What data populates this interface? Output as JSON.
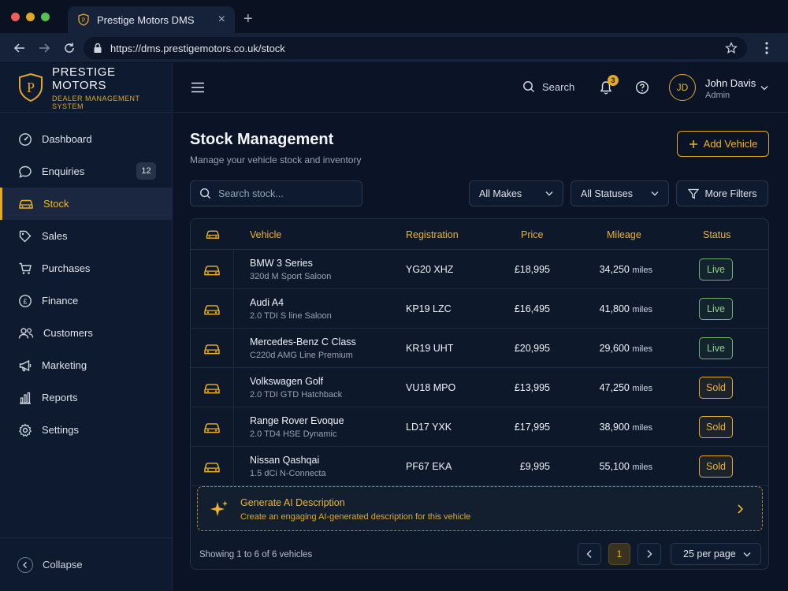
{
  "browser": {
    "tab_title": "Prestige Motors DMS",
    "url": "https://dms.prestigemotors.co.uk/stock"
  },
  "brand": {
    "name": "PRESTIGE MOTORS",
    "subtitle": "DEALER MANAGEMENT SYSTEM",
    "logo_letter": "P"
  },
  "sidebar": {
    "items": [
      {
        "label": "Dashboard",
        "icon": "gauge-icon"
      },
      {
        "label": "Enquiries",
        "icon": "chat-bubble-icon",
        "badge": "12"
      },
      {
        "label": "Stock",
        "icon": "car-icon",
        "active": true
      },
      {
        "label": "Sales",
        "icon": "tag-icon"
      },
      {
        "label": "Purchases",
        "icon": "cart-icon"
      },
      {
        "label": "Finance",
        "icon": "pound-icon"
      },
      {
        "label": "Customers",
        "icon": "users-icon"
      },
      {
        "label": "Marketing",
        "icon": "megaphone-icon"
      },
      {
        "label": "Reports",
        "icon": "bar-chart-icon"
      },
      {
        "label": "Settings",
        "icon": "gear-icon"
      }
    ],
    "collapse_label": "Collapse"
  },
  "header": {
    "search_label": "Search",
    "notification_count": "3",
    "user": {
      "initials": "JD",
      "name": "John Davis",
      "role": "Admin"
    }
  },
  "main": {
    "title": "Stock Management",
    "subtitle": "Manage your vehicle stock and inventory",
    "add_button": "Add Vehicle",
    "search_placeholder": "Search stock...",
    "filters": {
      "makes": "All Makes",
      "statuses": "All Statuses",
      "more": "More Filters"
    },
    "table": {
      "headers": {
        "vehicle": "Vehicle",
        "registration": "Registration",
        "price": "Price",
        "mileage": "Mileage",
        "status": "Status"
      },
      "mileage_unit": "miles",
      "rows": [
        {
          "name": "BMW 3 Series",
          "spec": "320d M Sport Saloon",
          "registration": "YG20 XHZ",
          "price": "£18,995",
          "mileage": "34,250",
          "status": "Live"
        },
        {
          "name": "Audi A4",
          "spec": "2.0 TDI S line Saloon",
          "registration": "KP19 LZC",
          "price": "£16,495",
          "mileage": "41,800",
          "status": "Live"
        },
        {
          "name": "Mercedes-Benz C Class",
          "spec": "C220d AMG Line Premium",
          "registration": "KR19 UHT",
          "price": "£20,995",
          "mileage": "29,600",
          "status": "Live"
        },
        {
          "name": "Volkswagen Golf",
          "spec": "2.0 TDI GTD Hatchback",
          "registration": "VU18 MPO",
          "price": "£13,995",
          "mileage": "47,250",
          "status": "Sold"
        },
        {
          "name": "Range Rover Evoque",
          "spec": "2.0 TD4 HSE Dynamic",
          "registration": "LD17 YXK",
          "price": "£17,995",
          "mileage": "38,900",
          "status": "Sold"
        },
        {
          "name": "Nissan Qashqai",
          "spec": "1.5 dCi N-Connecta",
          "registration": "PF67 EKA",
          "price": "£9,995",
          "mileage": "55,100",
          "status": "Sold"
        }
      ]
    },
    "ai_banner": {
      "title": "Generate AI Description",
      "subtitle": "Create an engaging AI-generated description for this vehicle"
    },
    "pagination": {
      "summary": "Showing 1 to 6 of 6 vehicles",
      "current_page": "1",
      "per_page": "25 per page"
    }
  },
  "colors": {
    "accent": "#e5a823",
    "background": "#0b1426",
    "sidebar": "#0e1a2f",
    "live": "#6fb26a"
  }
}
